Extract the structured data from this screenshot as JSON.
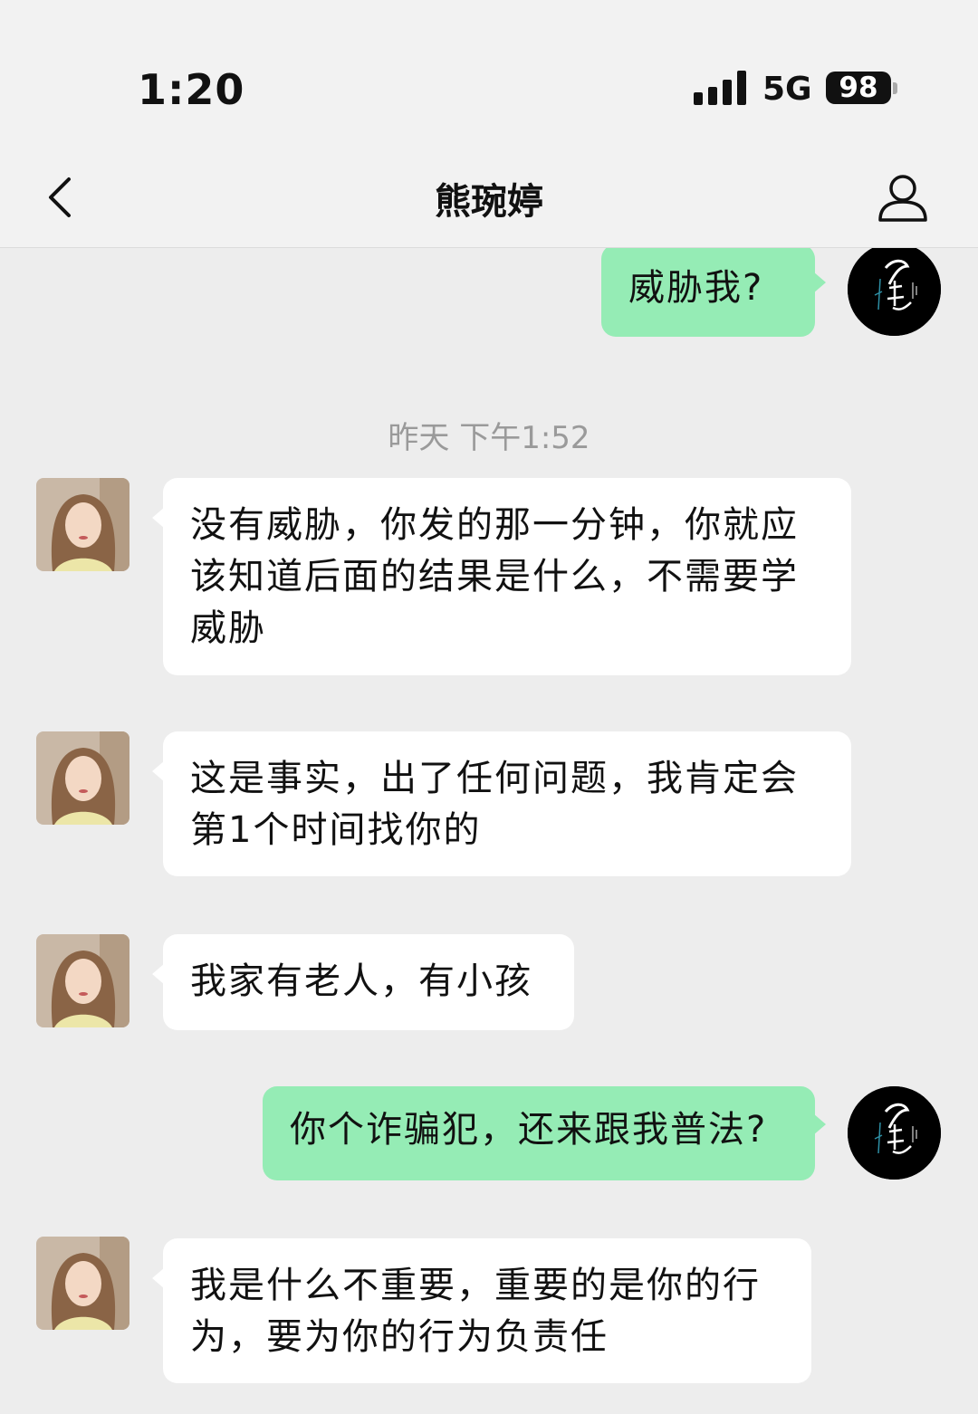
{
  "status_bar": {
    "time": "1:20",
    "network": "5G",
    "battery": "98"
  },
  "nav": {
    "title": "熊琬婷",
    "back_icon": "chevron-left-icon",
    "profile_icon": "person-icon"
  },
  "messages": [
    {
      "side": "out",
      "text": "威胁我?"
    },
    {
      "type": "timestamp",
      "text": "昨天 下午1:52"
    },
    {
      "side": "in",
      "lines": [
        "没有威胁，你发的那一分钟，你就应",
        "该知道后面的结果是什么，不需要学",
        "威胁"
      ]
    },
    {
      "side": "in",
      "lines": [
        "这是事实，出了任何问题，我肯定会",
        "第1个时间找你的"
      ]
    },
    {
      "side": "in",
      "lines": [
        "我家有老人，有小孩"
      ]
    },
    {
      "side": "out",
      "text": "你个诈骗犯，还来跟我普法?"
    },
    {
      "side": "in",
      "lines": [
        "我是什么不重要，重要的是你的行",
        "为，要为你的行为负责任"
      ]
    }
  ],
  "colors": {
    "outgoing_bubble": "#95ecb5",
    "incoming_bubble": "#ffffff",
    "background": "#ededed"
  }
}
